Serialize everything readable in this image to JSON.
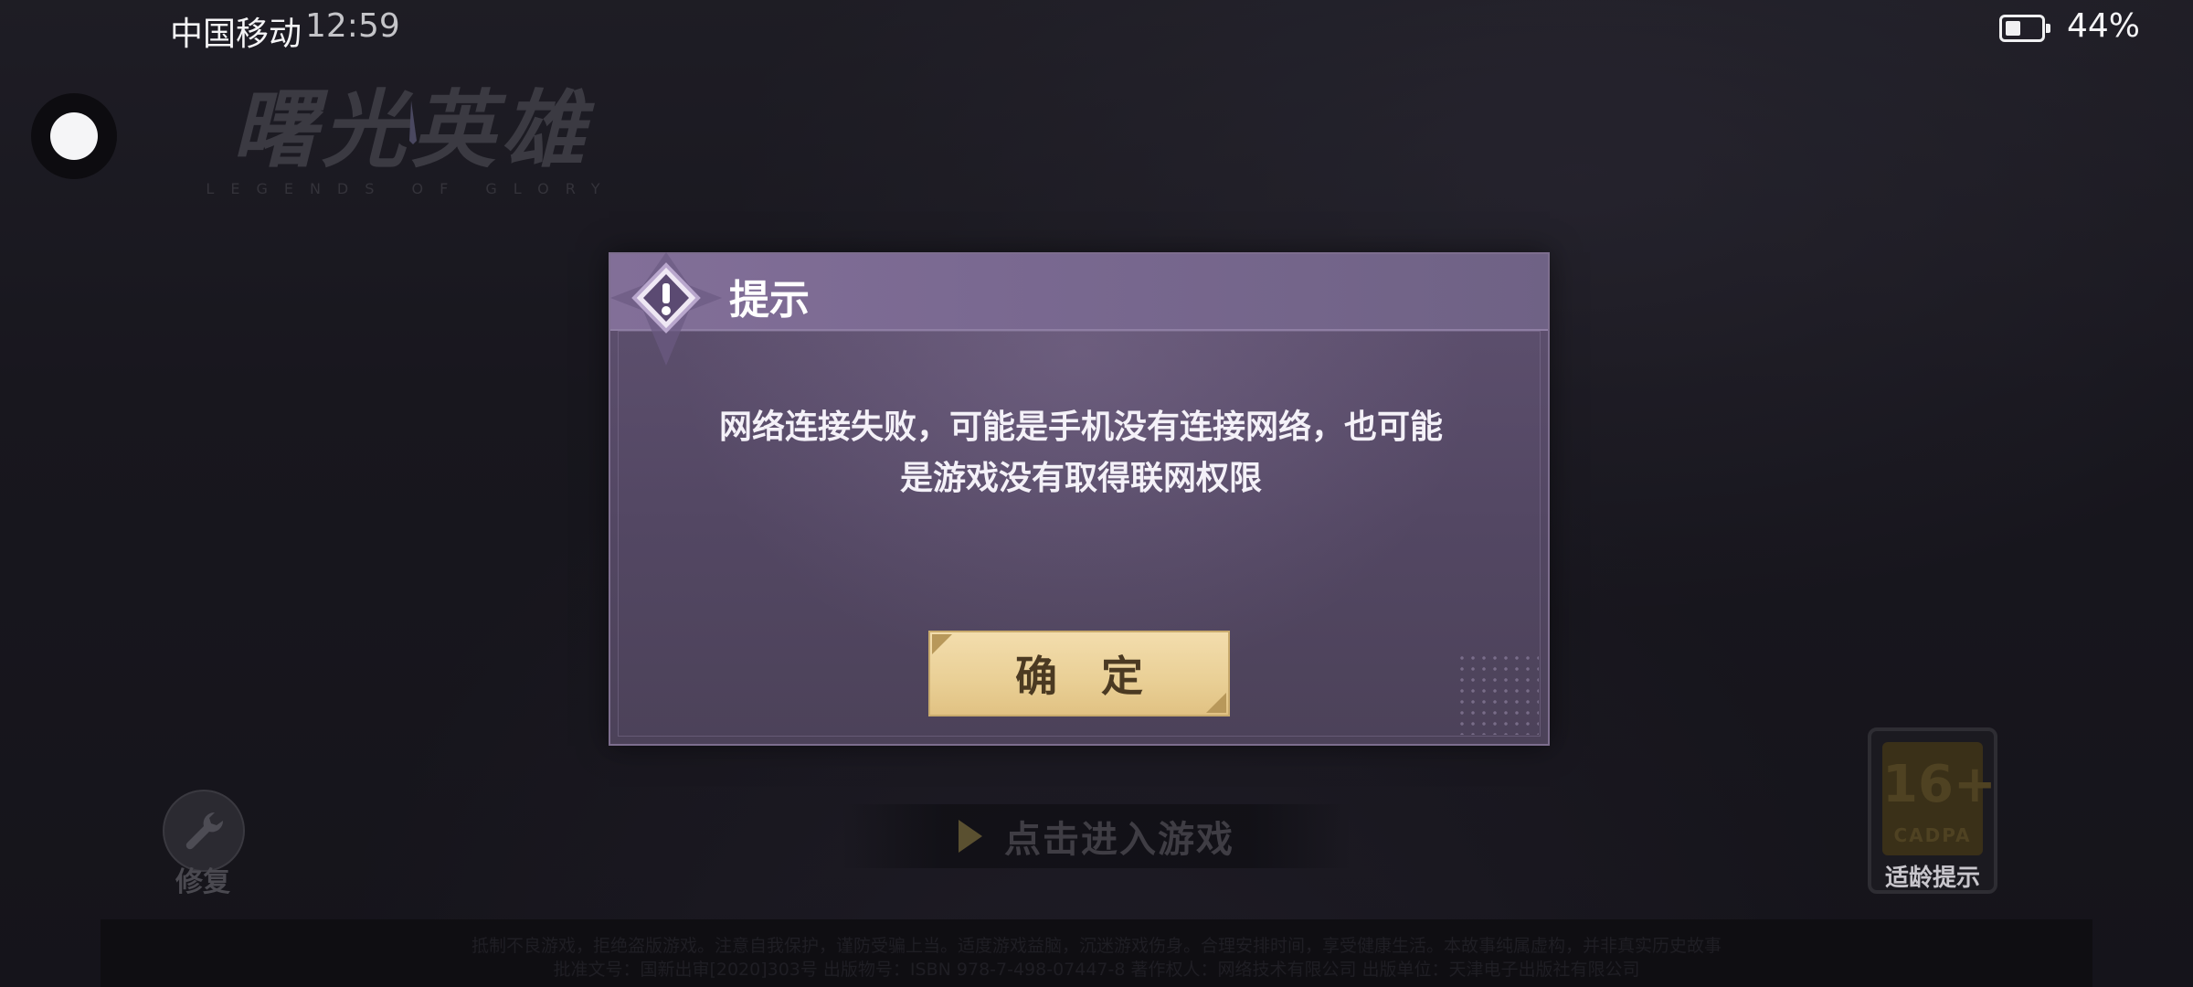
{
  "status_bar": {
    "carrier": "中国移动",
    "time": "12:59",
    "battery_percent": "44%",
    "battery_level": 0.44
  },
  "game": {
    "logo_text": "曙光英雄",
    "logo_subtitle": "LEGENDS OF GLORY"
  },
  "dialog": {
    "title": "提示",
    "message": "网络连接失败，可能是手机没有连接网络，也可能是游戏没有取得联网权限",
    "confirm_label": "确 定",
    "emblem_icon": "alert-diamond-icon"
  },
  "repair": {
    "label": "修复",
    "icon": "wrench-icon"
  },
  "enter_game": {
    "label": "点击进入游戏",
    "icon": "play-arrow-icon"
  },
  "age_rating": {
    "number": "16+",
    "org": "CADPA",
    "label": "适龄提示"
  },
  "footer": {
    "line1": "抵制不良游戏，拒绝盗版游戏。注意自我保护，谨防受骗上当。适度游戏益脑，沉迷游戏伤身。合理安排时间，享受健康生活。本故事纯属虚构，并非真实历史故事",
    "line2": "批准文号：国新出审[2020]303号  出版物号：ISBN 978-7-498-07447-8  著作权人：网络技术有限公司  出版单位：天津电子出版社有限公司"
  },
  "colors": {
    "dialog_header": "#7a6991",
    "dialog_body": "#534763",
    "confirm_button": "#e9cf95",
    "confirm_text": "#4b3a22"
  }
}
